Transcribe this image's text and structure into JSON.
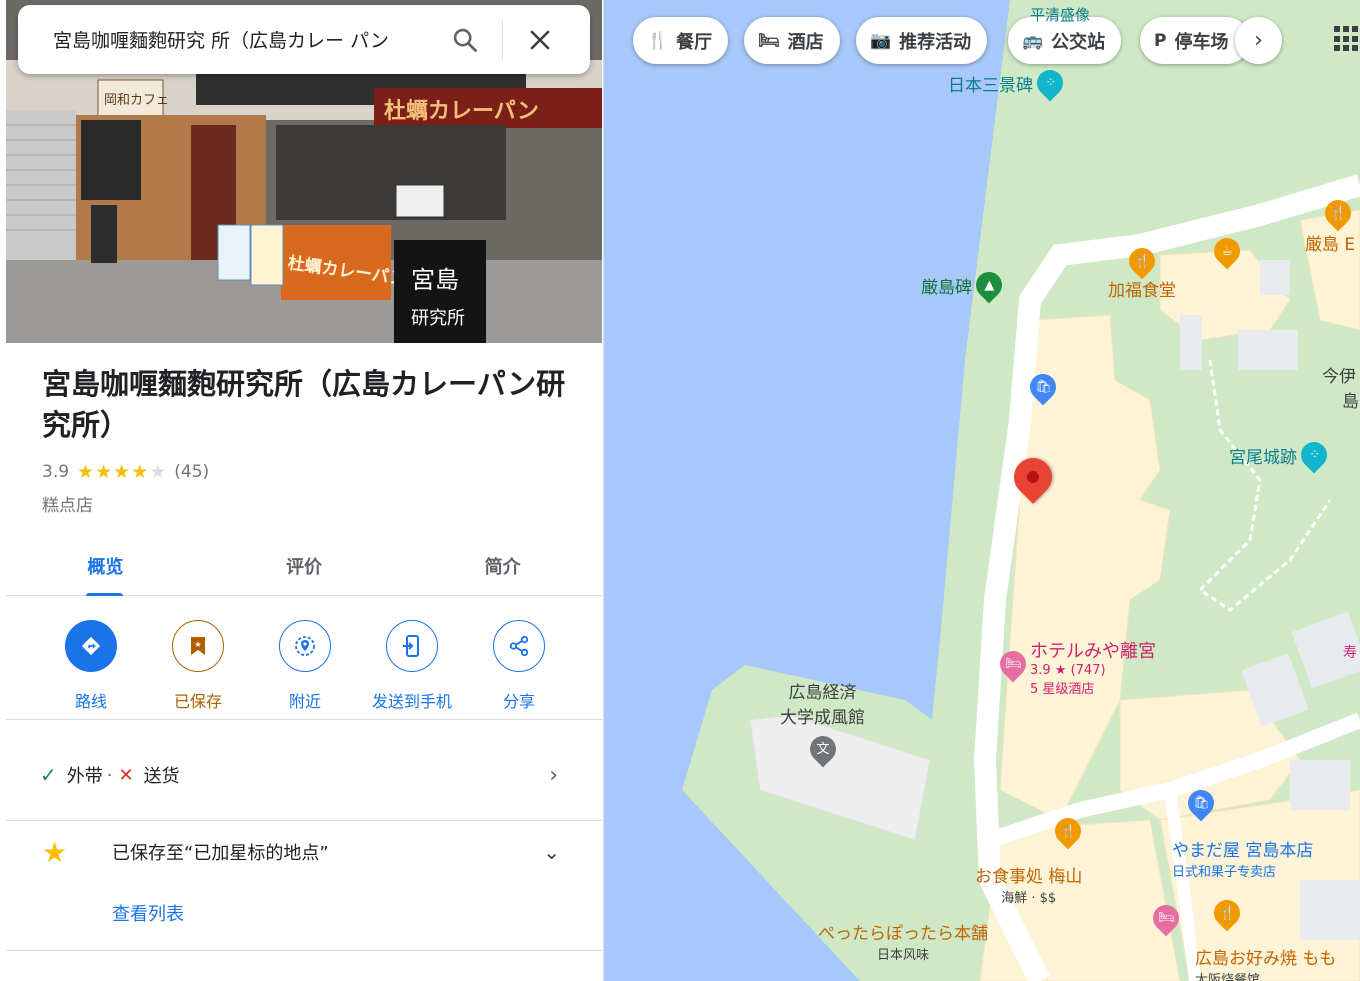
{
  "search": {
    "query": "宮島咖喱麵麭研究 所（広島カレー パン",
    "search_icon": "search-icon",
    "close_icon": "close-icon"
  },
  "place": {
    "name": "宮島咖喱麵麭研究所（広島カレーパン研究所）",
    "rating": "3.9",
    "stars": 4,
    "review_count": "(45)",
    "category": "糕点店"
  },
  "photo": {
    "shop_sign_main": "杜蠣カレーパン",
    "shop_sign_left": "岡和カフェ",
    "board_text_1": "宮島",
    "board_text_2": "研究所",
    "banner_text": "杜蠣カレーパン"
  },
  "tabs": [
    {
      "label": "概览",
      "active": true
    },
    {
      "label": "评价",
      "active": false
    },
    {
      "label": "简介",
      "active": false
    }
  ],
  "actions": [
    {
      "label": "路线",
      "icon": "directions-icon"
    },
    {
      "label": "已保存",
      "icon": "bookmark-icon"
    },
    {
      "label": "附近",
      "icon": "nearby-icon"
    },
    {
      "label": "发送到手机",
      "icon": "phone-icon"
    },
    {
      "label": "分享",
      "icon": "share-icon"
    }
  ],
  "services": {
    "takeout": "外带",
    "separator": "·",
    "delivery": "送货"
  },
  "saved": {
    "text": "已保存至“已加星标的地点”",
    "view_list": "查看列表"
  },
  "map": {
    "chips": [
      {
        "label": "餐厅",
        "icon": "restaurant-icon"
      },
      {
        "label": "酒店",
        "icon": "hotel-icon"
      },
      {
        "label": "推荐活动",
        "icon": "camera-icon"
      },
      {
        "label": "公交站",
        "icon": "bus-icon"
      },
      {
        "label": "停车场",
        "icon": "parking-icon"
      }
    ],
    "pois": {
      "nihon_sankei": "日本三景碑",
      "itsukushima_hi": "厳島碑",
      "kafuku": "加福食堂",
      "itsukushima_e": "厳島 E",
      "imai": "今伊",
      "imai2": "島",
      "miyao": "宮尾城跡",
      "hotel_name": "ホテルみや離宮",
      "hotel_rating": "3.9 ★ (747)",
      "hotel_class": "5 星级酒店",
      "univ_1": "広島経済",
      "univ_2": "大学成風館",
      "yamadaya": "やまだ屋 宮島本店",
      "yamadaya_sub": "日式和果子专卖店",
      "umeyama": "お食事処 梅山",
      "umeyama_sub": "海鮮 · $$",
      "pettara": "ぺったらぽったら本舗",
      "pettara_sub": "日本风味",
      "okonomi": "広島お好み焼 もも",
      "okonomi_sub": "大阪烧餐馆",
      "top_label": "平清盛像",
      "edge_right": "寿"
    }
  },
  "colors": {
    "water": "#a8c7fa",
    "land": "#e2f0d9",
    "building": "#fdf3d6",
    "accent": "#1a73e8",
    "saved": "#b06000"
  }
}
